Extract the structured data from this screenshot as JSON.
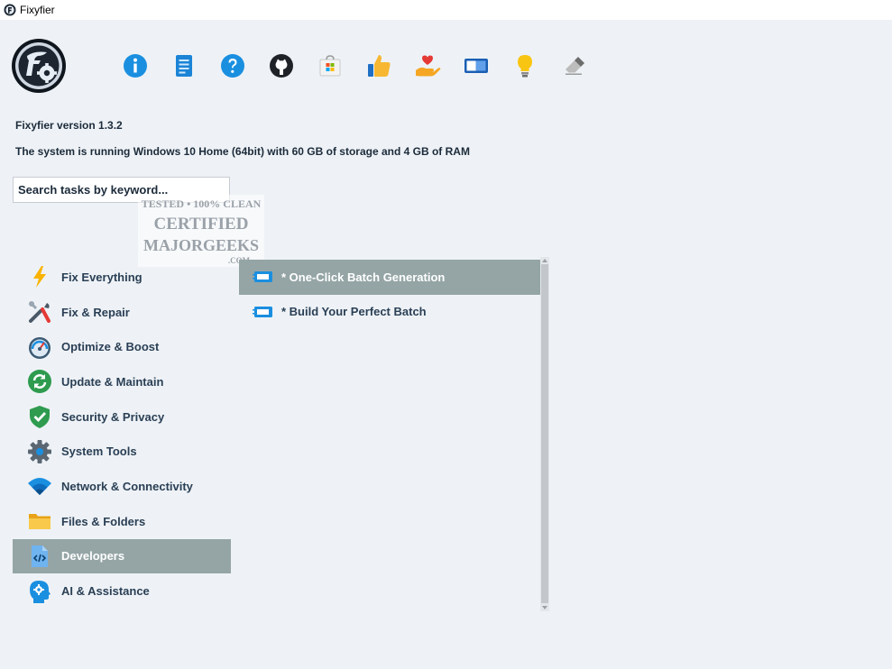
{
  "window": {
    "title": "Fixyfier"
  },
  "toolbar": {
    "icons": [
      "info-icon",
      "changelog-icon",
      "help-icon",
      "github-icon",
      "store-icon",
      "like-icon",
      "donate-icon",
      "display-icon",
      "tips-icon",
      "eraser-icon"
    ]
  },
  "info": {
    "version": "Fixyfier version 1.3.2",
    "system": "The system is running Windows 10 Home (64bit) with 60 GB of storage and 4 GB of RAM"
  },
  "search": {
    "placeholder": "Search tasks by keyword..."
  },
  "watermark": {
    "line1": "TESTED • 100% CLEAN",
    "line2": "CERTIFIED",
    "line3": "MAJORGEEKS",
    "line4": ".COM"
  },
  "categories": [
    {
      "label": "Fix Everything",
      "icon": "lightning-icon"
    },
    {
      "label": "Fix & Repair",
      "icon": "tools-icon"
    },
    {
      "label": "Optimize & Boost",
      "icon": "speedometer-icon"
    },
    {
      "label": "Update & Maintain",
      "icon": "refresh-icon"
    },
    {
      "label": "Security & Privacy",
      "icon": "shield-icon"
    },
    {
      "label": "System Tools",
      "icon": "gear-icon"
    },
    {
      "label": "Network & Connectivity",
      "icon": "wifi-icon"
    },
    {
      "label": "Files & Folders",
      "icon": "folder-icon"
    },
    {
      "label": "Developers",
      "icon": "code-file-icon",
      "selected": true
    },
    {
      "label": "AI & Assistance",
      "icon": "ai-head-icon"
    }
  ],
  "tasks": [
    {
      "label": "* One-Click Batch Generation",
      "icon": "batch-icon",
      "selected": true
    },
    {
      "label": "* Build Your Perfect Batch",
      "icon": "batch-icon"
    }
  ],
  "colors": {
    "selected_bg": "#95a5a6",
    "background": "#eef2f6",
    "text": "#2a3f55"
  }
}
